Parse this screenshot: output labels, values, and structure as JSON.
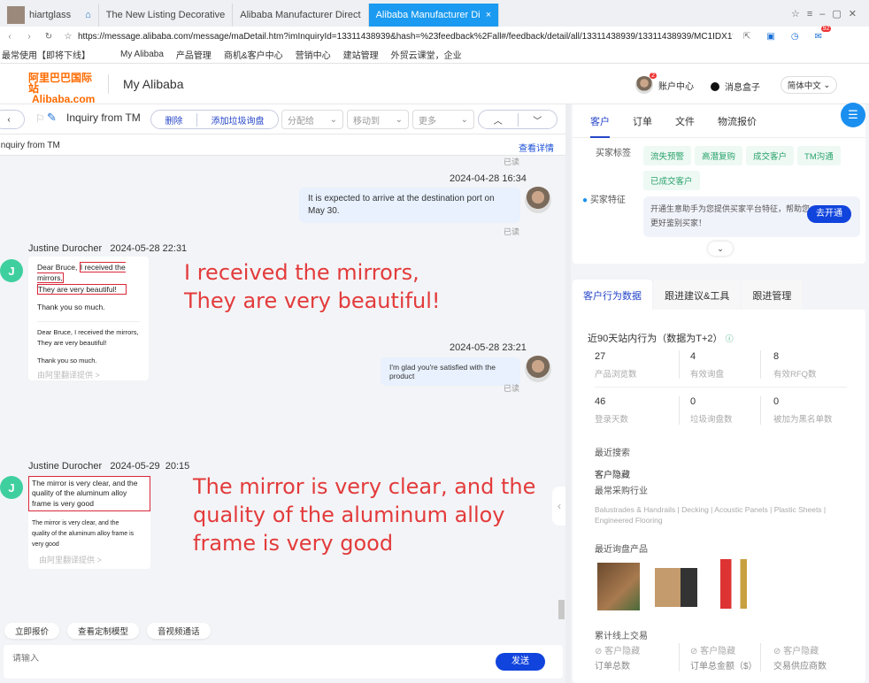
{
  "browser": {
    "profile": "hiartglass",
    "tabs": [
      {
        "label": "The New Listing Decorative"
      },
      {
        "label": "Alibaba Manufacturer Direct"
      },
      {
        "label": "Alibaba Manufacturer Di",
        "close": "×"
      }
    ],
    "url": "https://message.alibaba.com/message/maDetail.htm?imInquiryId=13311438939&hash=%23feedback%2Fall#/feedback/detail/all/13311438939/13311438939/MC1IDX1f5",
    "mail_badge": "92",
    "bookmarks": [
      "最常使用【即将下线】",
      "My Alibaba",
      "产品管理",
      "商机&客户中心",
      "营销中心",
      "建站管理",
      "外贸云课堂，企业"
    ]
  },
  "header": {
    "logo_cn": "阿里巴巴国际站",
    "logo_en": "Alibaba.com",
    "title": "My Alibaba",
    "account_badge": "2",
    "account": "账户中心",
    "messages": "消息盒子",
    "language": "简体中文"
  },
  "toolbar": {
    "title": "Inquiry from TM",
    "delete": "删除",
    "add_spam": "添加垃圾询盘",
    "assign": "分配给",
    "move": "移动到",
    "more": "更多"
  },
  "strip": {
    "subject": "Inquiry from TM",
    "details": "查看详情"
  },
  "chat": {
    "read_top": "已读",
    "m1": {
      "time": "2024-04-28 16:34",
      "text": "It is expected to arrive at the destination port on May 30.",
      "status": "已读"
    },
    "m2": {
      "sender": "Justine Durocher",
      "time": "2024-05-28 22:31",
      "p1a": "Dear Bruce, ",
      "p1b": "I received the mirrors,",
      "p2": "They are very beautiful!",
      "p3": "Thank you so much.",
      "t1": "Dear Bruce, I received the mirrors,",
      "t2": "They are very beautiful!",
      "t3": "Thank you so much.",
      "translate": "由阿里翻译提供 >",
      "avatar": "J"
    },
    "annot1": [
      "I received the mirrors,",
      "They are very beautiful!"
    ],
    "m3": {
      "time": "2024-05-28 23:21",
      "text": "I'm glad you're satisfied with the product",
      "status": "已读"
    },
    "m4": {
      "sender": "Justine Durocher",
      "time": "2024-05-29  20:15",
      "text": "The mirror is very clear, and the quality of the aluminum alloy frame is very good",
      "t1": "The mirror is very clear, and the",
      "t2": "quality of the aluminum alloy frame is",
      "t3": "very good",
      "translate": "由阿里翻译提供 >",
      "avatar": "J"
    },
    "annot2": [
      "The mirror is very clear, and the",
      "quality of the aluminum alloy",
      "frame is very good"
    ]
  },
  "quick": [
    "立即报价",
    "查看定制模型",
    "音视频通话"
  ],
  "input": {
    "placeholder": "请输入",
    "send": "发送"
  },
  "right": {
    "tabs": [
      "客户",
      "订单",
      "文件",
      "物流报价"
    ],
    "tags_label": "买家标签",
    "tags": [
      "流失预警",
      "高潜复购",
      "成交客户",
      "TM沟通",
      "已成交客户"
    ],
    "feature_label": "买家特征",
    "feature_text": "开通生意助手为您提供买家平台特征，帮助您更好鉴别买家！",
    "feature_btn": "去开通",
    "subtabs": [
      "客户行为数据",
      "跟进建议&工具",
      "跟进管理"
    ],
    "behavior_title": "近90天站内行为（数据为T+2）",
    "stats": [
      {
        "n": "27",
        "l": "产品浏览数"
      },
      {
        "n": "4",
        "l": "有效询盘"
      },
      {
        "n": "8",
        "l": "有效RFQ数"
      },
      {
        "n": "46",
        "l": "登录天数"
      },
      {
        "n": "0",
        "l": "垃圾询盘数"
      },
      {
        "n": "0",
        "l": "被加为黑名单数"
      }
    ],
    "recent_search": "最近搜索",
    "hidden": "客户隐藏",
    "industry_label": "最常采购行业",
    "industries": "Balustrades & Handrails | Decking | Acoustic Panels | Plastic Sheets | Engineered Flooring",
    "recent_products": "最近询盘产品",
    "trade_label": "累计线上交易",
    "trade": [
      {
        "v": "客户隐藏",
        "l": "订单总数"
      },
      {
        "v": "客户隐藏",
        "l": "订单总金额（$）"
      },
      {
        "v": "客户隐藏",
        "l": "交易供应商数"
      }
    ]
  }
}
